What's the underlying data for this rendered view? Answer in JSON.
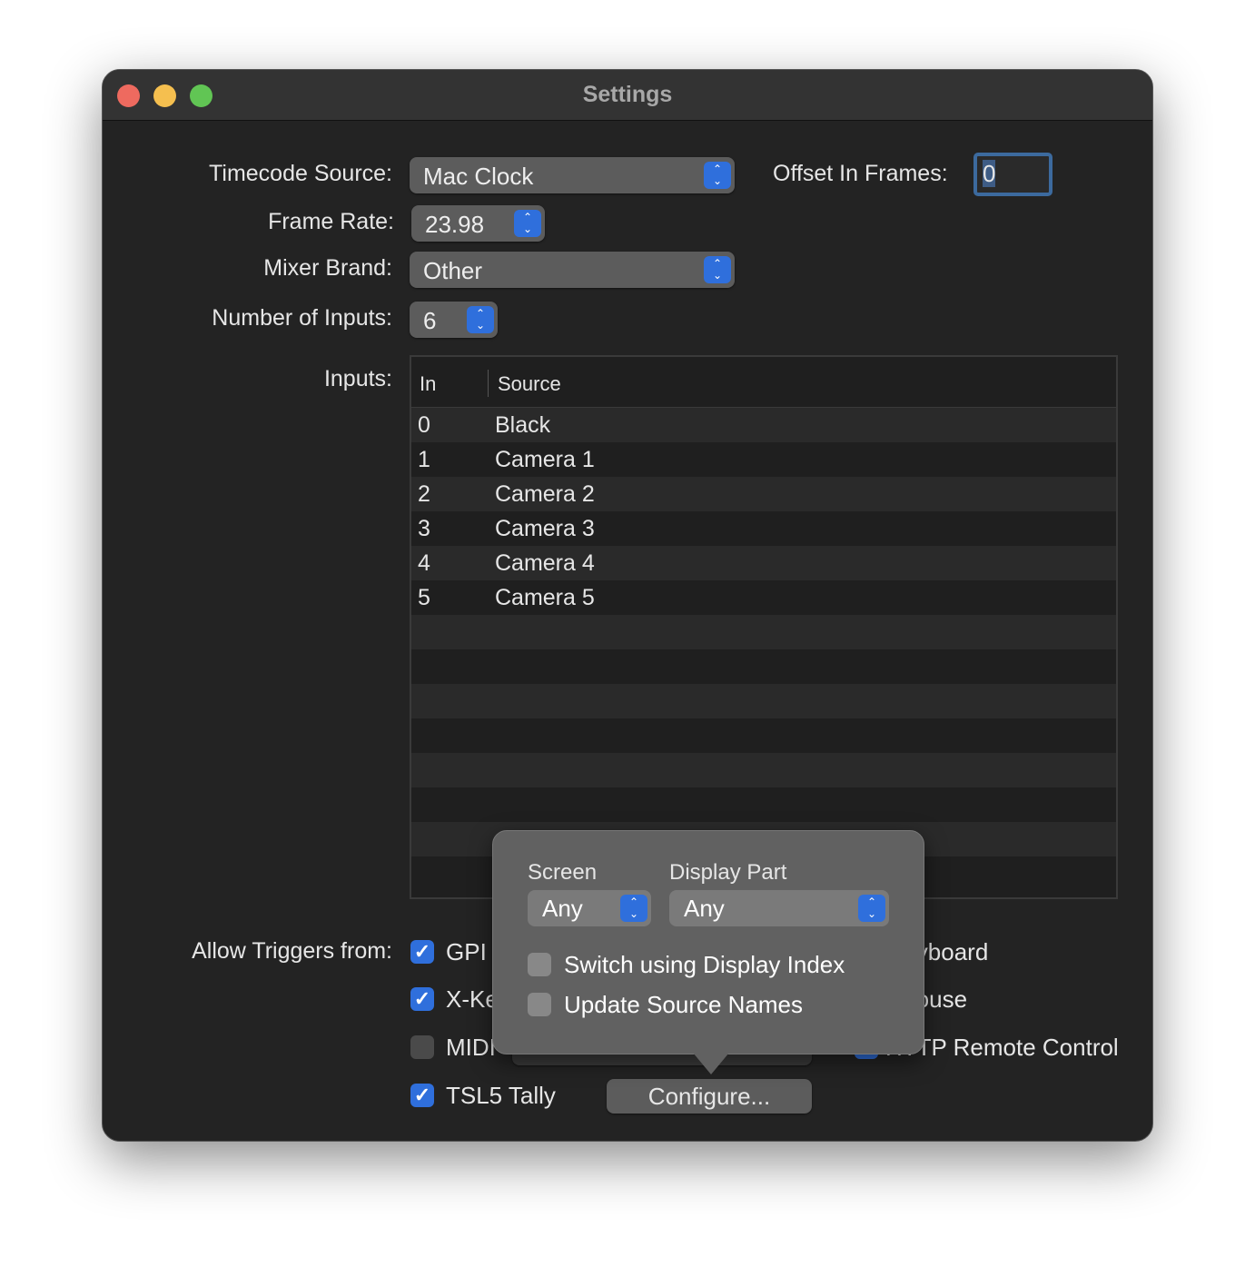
{
  "window": {
    "title": "Settings"
  },
  "form": {
    "timecode_source_label": "Timecode Source:",
    "timecode_source_value": "Mac Clock",
    "offset_label": "Offset In Frames:",
    "offset_value": "0",
    "frame_rate_label": "Frame Rate:",
    "frame_rate_value": "23.98",
    "mixer_brand_label": "Mixer Brand:",
    "mixer_brand_value": "Other",
    "inputs_count_label": "Number of Inputs:",
    "inputs_count_value": "6",
    "inputs_label": "Inputs:"
  },
  "table": {
    "columns": [
      "In",
      "Source"
    ],
    "rows": [
      [
        "0",
        "Black"
      ],
      [
        "1",
        "Camera 1"
      ],
      [
        "2",
        "Camera 2"
      ],
      [
        "3",
        "Camera 3"
      ],
      [
        "4",
        "Camera 4"
      ],
      [
        "5",
        "Camera 5"
      ]
    ]
  },
  "triggers": {
    "label": "Allow Triggers from:",
    "items": [
      {
        "label": "GPI",
        "checked": true
      },
      {
        "label": "X-Keys",
        "checked": true
      },
      {
        "label": "MIDI",
        "checked": false
      },
      {
        "label": "TSL5 Tally",
        "checked": true
      },
      {
        "label": "Keyboard",
        "checked": true
      },
      {
        "label": "Mouse",
        "checked": true
      },
      {
        "label": "HTTP Remote Control",
        "checked": true
      }
    ],
    "configure_label": "Configure..."
  },
  "popover": {
    "screen_label": "Screen",
    "screen_value": "Any",
    "display_part_label": "Display Part",
    "display_part_value": "Any",
    "switch_index_label": "Switch using Display Index",
    "switch_index_checked": false,
    "update_names_label": "Update Source Names",
    "update_names_checked": false
  },
  "colors": {
    "accent": "#2f6fdc",
    "close": "#ee6a5f",
    "minimize": "#f5bf4f",
    "zoom": "#61c554"
  }
}
